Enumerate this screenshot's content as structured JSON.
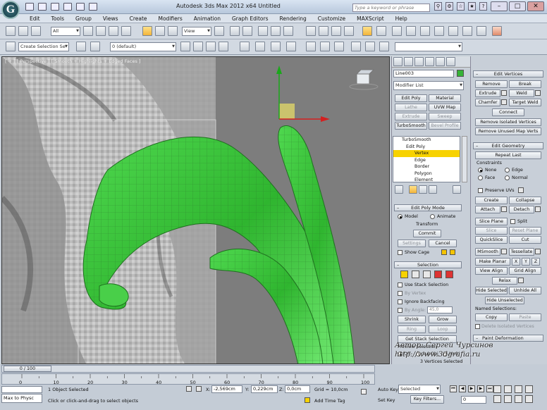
{
  "app": {
    "logo_letter": "G",
    "title": "Autodesk 3ds Max  2012 x64     Untitled",
    "search_placeholder": "Type a keyword or phrase"
  },
  "menu": [
    "Edit",
    "Tools",
    "Group",
    "Views",
    "Create",
    "Modifiers",
    "Animation",
    "Graph Editors",
    "Rendering",
    "Customize",
    "MAXScript",
    "Help"
  ],
  "toolbar": {
    "selection_filter": "All",
    "ref_coord": "View",
    "named_selection": "Create Selection Se",
    "layer": "0 (default)"
  },
  "viewport": {
    "label": "[ + ] [ Perspective ] [ Smooth + Highlights + Edged Faces ]"
  },
  "command_panel": {
    "object_name": "Line003",
    "modifier_list": "Modifier List",
    "quick_buttons": [
      "Edit Poly",
      "Material",
      "Lathe",
      "UVW Map",
      "Extrude",
      "Sweep",
      "TurboSmooth",
      "Bevel Profile"
    ],
    "stack": [
      "TurboSmooth",
      "Edit Poly",
      "Vertex",
      "Edge",
      "Border",
      "Polygon",
      "Element"
    ],
    "edit_poly_mode": {
      "header": "Edit Poly Mode",
      "model": "Model",
      "animate": "Animate",
      "transform": "Transform",
      "commit": "Commit",
      "settings": "Settings",
      "cancel": "Cancel",
      "show_cage": "Show Cage"
    },
    "selection": {
      "header": "Selection",
      "use_stack": "Use Stack Selection",
      "by_vertex": "By Vertex",
      "ignore_backfacing": "Ignore Backfacing",
      "by_angle": "By Angle:",
      "angle_value": "45,0",
      "shrink": "Shrink",
      "grow": "Grow",
      "ring": "Ring",
      "loop": "Loop",
      "get_stack": "Get Stack Selection",
      "preview": "Preview Selection",
      "off": "Off",
      "subobj": "SubObj",
      "multi": "Multi",
      "count": "3 Vertices Selected"
    }
  },
  "right_panel": {
    "edit_vertices": {
      "header": "Edit Vertices",
      "remove": "Remove",
      "break": "Break",
      "extrude": "Extrude",
      "weld": "Weld",
      "chamfer": "Chamfer",
      "target_weld": "Target Weld",
      "connect": "Connect",
      "remove_isolated": "Remove Isolated Vertices",
      "remove_unused": "Remove Unused Map Verts"
    },
    "edit_geometry": {
      "header": "Edit Geometry",
      "repeat_last": "Repeat Last",
      "constraints": "Constraints",
      "none": "None",
      "edge": "Edge",
      "face": "Face",
      "normal": "Normal",
      "preserve_uvs": "Preserve UVs",
      "create": "Create",
      "collapse": "Collapse",
      "attach": "Attach",
      "detach": "Detach",
      "slice_plane": "Slice Plane",
      "split": "Split",
      "slice": "Slice",
      "reset_plane": "Reset Plane",
      "quickslice": "QuickSlice",
      "cut": "Cut",
      "msmooth": "MSmooth",
      "tessellate": "Tessellate",
      "make_planar": "Make Planar",
      "x": "X",
      "y": "Y",
      "z": "Z",
      "view_align": "View Align",
      "grid_align": "Grid Align",
      "relax": "Relax",
      "hide_selected": "Hide Selected",
      "unhide_all": "Unhide All",
      "hide_unselected": "Hide Unselected",
      "named_selections": "Named Selections:",
      "copy": "Copy",
      "paste": "Paste",
      "delete_isolated": "Delete Isolated Vertices"
    },
    "paint_deformation": "Paint Deformation"
  },
  "timeline": {
    "frame": "0 / 100",
    "ticks": [
      "0",
      "10",
      "20",
      "30",
      "40",
      "50",
      "60",
      "70",
      "80",
      "90",
      "100"
    ]
  },
  "statusbar": {
    "maxscript": "Max to Physc",
    "objects_selected": "1 Object Selected",
    "prompt": "Click or click-and-drag to select objects",
    "x_label": "X:",
    "x_value": "-2,569cm",
    "y_label": "Y:",
    "y_value": "0,229cm",
    "z_label": "Z:",
    "z_value": "0,0cm",
    "grid": "Grid = 10,0cm",
    "add_time_tag": "Add Time Tag",
    "auto_key": "Auto Key",
    "set_key": "Set Key",
    "key_mode": "Selected",
    "key_filters": "Key Filters...",
    "current_frame": "0"
  },
  "watermark": {
    "line1": "Автор: Сергей Чурсинов",
    "line2": "http://www.3dgrafia.ru"
  },
  "colors": {
    "mesh_green": "#3fbf3f",
    "selected_yellow": "#f7d200",
    "viewport_bg": "#7d7d7d"
  }
}
